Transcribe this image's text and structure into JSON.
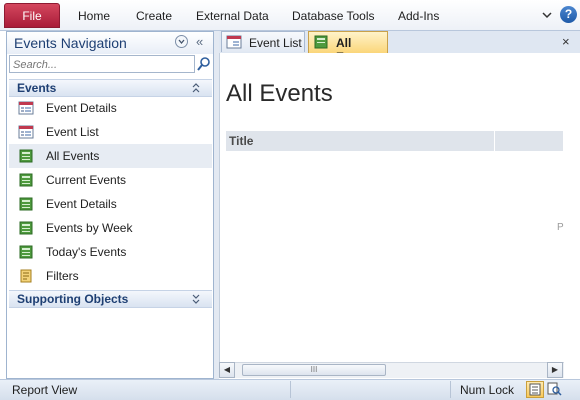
{
  "ribbon": {
    "file_label": "File",
    "tabs": [
      "Home",
      "Create",
      "External Data",
      "Database Tools",
      "Add-Ins"
    ],
    "help_label": "?"
  },
  "nav": {
    "title": "Events Navigation",
    "collapse_glyph": "«",
    "search_placeholder": "Search...",
    "groups": [
      {
        "label": "Events",
        "chevron": "⌃"
      },
      {
        "label": "Supporting Objects",
        "chevron": "⌄"
      }
    ],
    "items": [
      {
        "label": "Event Details",
        "icon": "form-icon"
      },
      {
        "label": "Event List",
        "icon": "form-icon"
      },
      {
        "label": "All Events",
        "icon": "report-icon",
        "selected": true
      },
      {
        "label": "Current Events",
        "icon": "report-icon"
      },
      {
        "label": "Event Details",
        "icon": "report-icon"
      },
      {
        "label": "Events by Week",
        "icon": "report-icon"
      },
      {
        "label": "Today's Events",
        "icon": "report-icon"
      },
      {
        "label": "Filters",
        "icon": "query-icon"
      }
    ]
  },
  "doc_tabs": [
    {
      "label": "Event List",
      "active": false
    },
    {
      "label": "All Events",
      "active": true
    }
  ],
  "doc_close": "×",
  "report": {
    "title": "All Events",
    "column_header": "Title",
    "edge_char": "P"
  },
  "scrollbar": {
    "thumb_grip": "III",
    "left_arrow": "◀",
    "right_arrow": "▶"
  },
  "status": {
    "view_label": "Report View",
    "num_lock": "Num Lock"
  },
  "colors": {
    "file_tab": "#a91c39",
    "active_tab": "#fbd67a",
    "nav_title": "#1e3f73",
    "group_header": "#d9e3f1"
  }
}
